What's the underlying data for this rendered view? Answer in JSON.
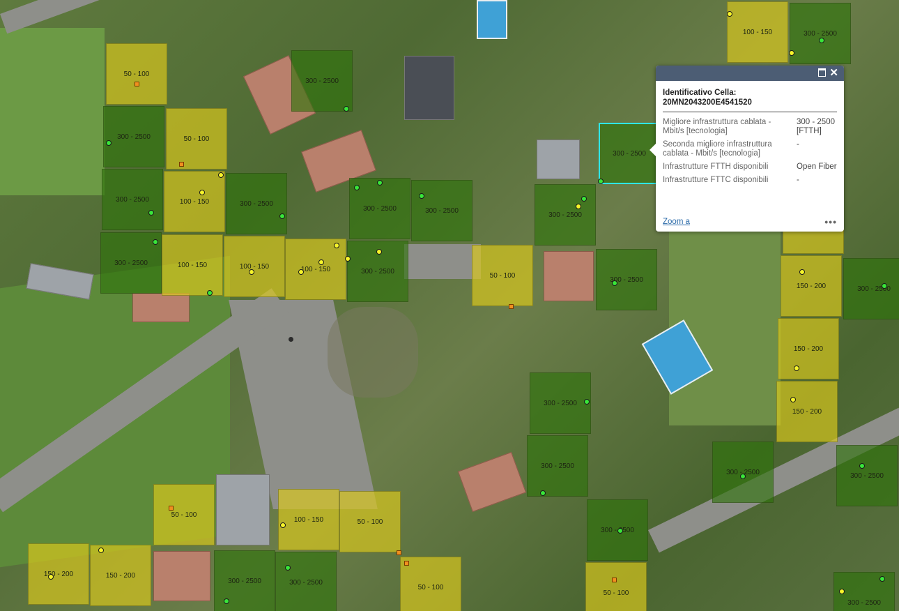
{
  "map": {
    "cells": [
      {
        "label": "50 - 100",
        "c": "y"
      },
      {
        "label": "300 - 2500",
        "c": "g"
      },
      {
        "label": "300 - 2500",
        "c": "g"
      },
      {
        "label": "50 - 100",
        "c": "y"
      },
      {
        "label": "300 - 2500",
        "c": "g"
      },
      {
        "label": "100 - 150",
        "c": "y"
      },
      {
        "label": "300 - 2500",
        "c": "g"
      },
      {
        "label": "300 - 2500",
        "c": "g"
      },
      {
        "label": "300 - 2500",
        "c": "g"
      },
      {
        "label": "300 - 2500",
        "c": "g"
      },
      {
        "label": "100 - 150",
        "c": "y"
      },
      {
        "label": "100 - 150",
        "c": "y"
      },
      {
        "label": "100 - 150",
        "c": "y"
      },
      {
        "label": "300 - 2500",
        "c": "g"
      },
      {
        "label": "300 - 2500",
        "c": "g"
      },
      {
        "label": "50 - 100",
        "c": "y"
      },
      {
        "label": "300 - 2500",
        "c": "g"
      },
      {
        "label": "300 - 2500",
        "c": "g"
      },
      {
        "label": "100 - 150",
        "c": "y"
      },
      {
        "label": "300 - 2500",
        "c": "g"
      },
      {
        "label": "150 - 200",
        "c": "y"
      },
      {
        "label": "300 - 2500",
        "c": "g"
      },
      {
        "label": "150 - 200",
        "c": "y"
      },
      {
        "label": "300 - 2500",
        "c": "g"
      },
      {
        "label": "150 - 200",
        "c": "y"
      },
      {
        "label": "300 - 2500",
        "c": "g"
      },
      {
        "label": "300 - 2500",
        "c": "g"
      },
      {
        "label": "300 - 2500",
        "c": "g"
      },
      {
        "label": "50 - 100",
        "c": "y"
      },
      {
        "label": "100 - 150",
        "c": "y"
      },
      {
        "label": "50 - 100",
        "c": "y"
      },
      {
        "label": "300 - 2500",
        "c": "g"
      },
      {
        "label": "150 - 200",
        "c": "y"
      },
      {
        "label": "150 - 200",
        "c": "y"
      },
      {
        "label": "300 - 2500",
        "c": "g"
      },
      {
        "label": "300 - 2500",
        "c": "g"
      },
      {
        "label": "50 - 100",
        "c": "y"
      },
      {
        "label": "50 - 100",
        "c": "y"
      },
      {
        "label": "300 - 2500",
        "c": "g"
      },
      {
        "label": "",
        "c": "y"
      }
    ],
    "colors": {
      "fiber_green": "#2d730a",
      "mid_yellow": "#dac81e",
      "selected": "#2ee6e6"
    }
  },
  "popup": {
    "title_line1": "Identificativo Cella:",
    "title_line2": "20MN2043200E4541520",
    "rows": [
      {
        "k": "Migliore infrastruttura cablata - Mbit/s [tecnologia]",
        "v": "300 - 2500 [FTTH]"
      },
      {
        "k": "Seconda migliore infrastruttura cablata - Mbit/s [tecnologia]",
        "v": "-"
      },
      {
        "k": "Infrastrutture FTTH disponibili",
        "v": "Open Fiber"
      },
      {
        "k": "Infrastrutture FTTC disponibili",
        "v": "-"
      }
    ],
    "zoom_label": "Zoom a",
    "more_label": "•••",
    "maximize_icon": "maximize-icon",
    "close_icon": "close-icon"
  }
}
